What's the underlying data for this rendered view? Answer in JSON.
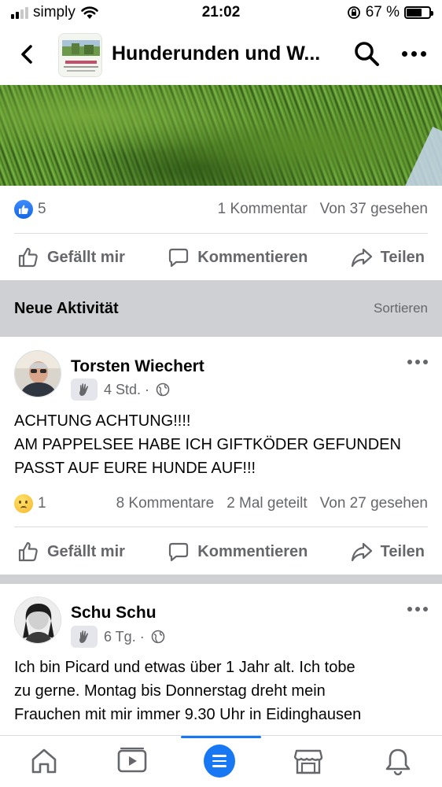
{
  "status_bar": {
    "carrier": "simply",
    "time": "21:02",
    "battery_percent": "67 %",
    "battery_level": 0.67
  },
  "header": {
    "group_title": "Hunderunden und W...",
    "back_icon": "chevron-left-icon",
    "search_icon": "search-icon",
    "more_icon": "more-horizontal-icon"
  },
  "post1": {
    "reaction_count": "5",
    "comments": "1 Kommentar",
    "views": "Von 37 gesehen",
    "actions": {
      "like": "Gefällt mir",
      "comment": "Kommentieren",
      "share": "Teilen"
    }
  },
  "activity": {
    "title": "Neue Aktivität",
    "sort": "Sortieren"
  },
  "post2": {
    "author": "Torsten Wiechert",
    "time": "4 Std. ·",
    "lines": [
      "ACHTUNG ACHTUNG!!!!",
      "AM PAPPELSEE HABE ICH GIFTKÖDER GEFUNDEN",
      "PASST AUF EURE HUNDE AUF!!!"
    ],
    "reaction_count": "1",
    "comments": "8 Kommentare",
    "shares": "2 Mal geteilt",
    "views": "Von 27 gesehen",
    "actions": {
      "like": "Gefällt mir",
      "comment": "Kommentieren",
      "share": "Teilen"
    }
  },
  "post3": {
    "author": "Schu Schu",
    "time": "6 Tg. ·",
    "lines": [
      "Ich bin Picard und etwas über 1 Jahr alt. Ich tobe",
      "zu gerne. Montag bis Donnerstag dreht mein",
      "Frauchen mit mir immer 9.30 Uhr in Eidinghausen"
    ]
  },
  "tabbar": {
    "items": [
      "home-icon",
      "video-icon",
      "menu-icon",
      "marketplace-icon",
      "notifications-icon"
    ],
    "active": "menu-icon"
  },
  "colors": {
    "accent": "#1877f2",
    "secondary_text": "#65676b",
    "band": "#ced0d4"
  }
}
